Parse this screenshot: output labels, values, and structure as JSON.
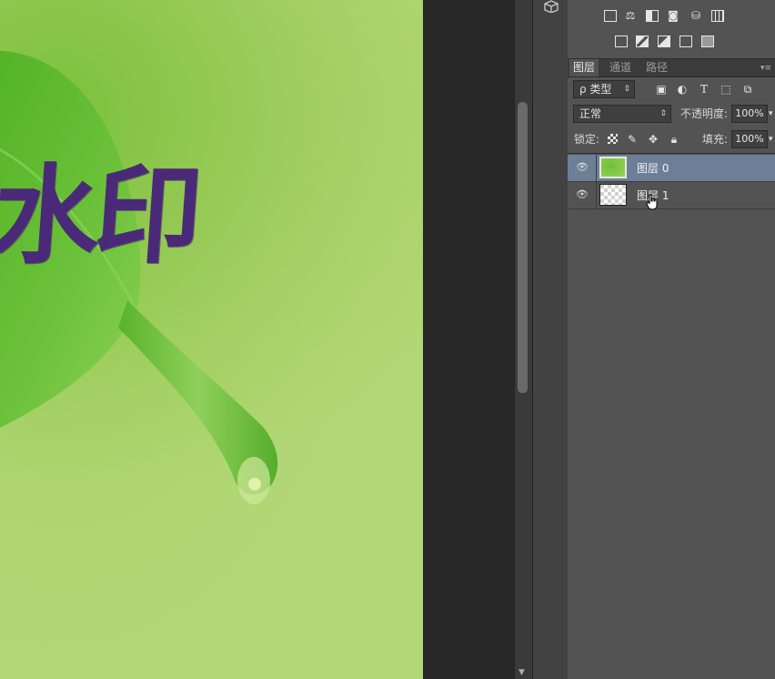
{
  "canvas": {
    "watermark_text": "水印",
    "colors": {
      "bg": "#a9d268",
      "leaf": "#5fb82c",
      "text": "#4a2a78"
    }
  },
  "layers_panel": {
    "tabs": [
      {
        "label": "图层",
        "active": true
      },
      {
        "label": "通道",
        "active": false
      },
      {
        "label": "路径",
        "active": false
      }
    ],
    "filter": {
      "label": "ρ 类型"
    },
    "blend_mode": {
      "value": "正常"
    },
    "opacity": {
      "label": "不透明度:",
      "value": "100%"
    },
    "lock": {
      "label": "锁定:"
    },
    "fill": {
      "label": "填充:",
      "value": "100%"
    },
    "layers": [
      {
        "name": "图层 0",
        "selected": true,
        "thumb": "green-image"
      },
      {
        "name": "图层 1",
        "selected": false,
        "thumb": "transparent"
      }
    ],
    "icons": {
      "filter_icons": [
        "image-filter-icon",
        "adjustment-filter-icon",
        "type-filter-icon",
        "shape-filter-icon",
        "smart-object-filter-icon"
      ],
      "lock_icons": [
        "lock-transparent-icon",
        "lock-paint-icon",
        "lock-position-icon",
        "lock-all-icon"
      ]
    }
  },
  "adjustments_panel": {
    "icons_row1": [
      "levels-icon",
      "balance-icon",
      "bw-icon",
      "photo-filter-icon",
      "channel-mixer-icon",
      "color-lookup-icon"
    ],
    "icons_row2": [
      "invert-icon",
      "posterize-icon",
      "threshold-icon",
      "gradient-map-icon",
      "selective-color-icon"
    ]
  }
}
